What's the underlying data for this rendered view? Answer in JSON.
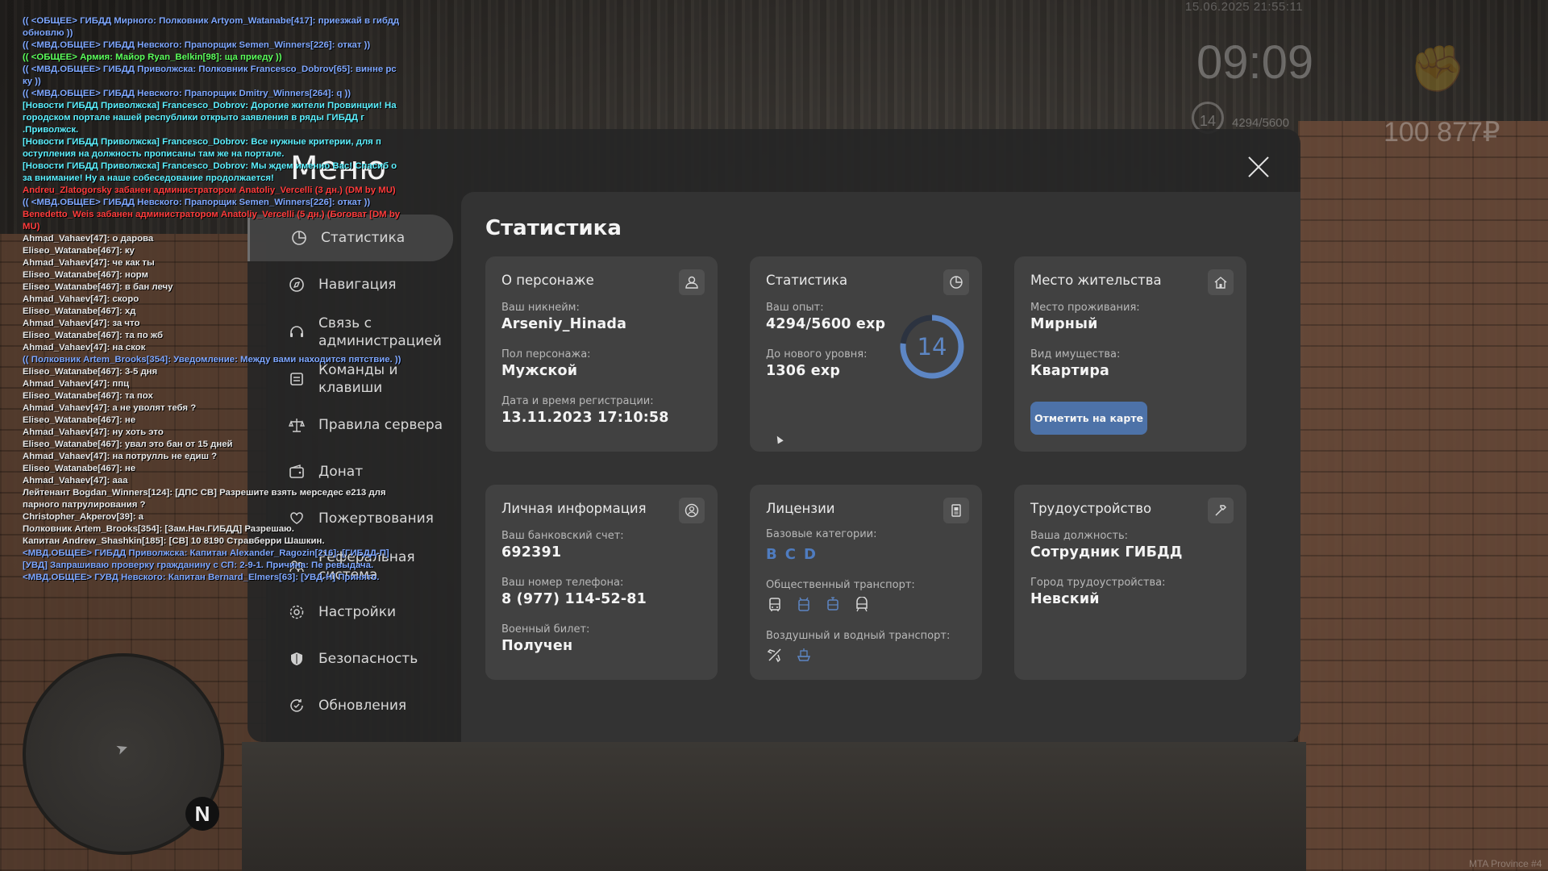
{
  "hud": {
    "date": "15.06.2025 21:55:11",
    "clock": "09:09",
    "level": "14",
    "exp": "4294/5600",
    "money": "100 877₽",
    "watermark": "MTA Province #4"
  },
  "chat": [
    {
      "c": "c-blue",
      "t": "(( <ОБЩЕЕ> ГИБДД Мирного: Полковник Artyom_Watanabe[417]: приезжай в гибдд обновлю ))"
    },
    {
      "c": "c-blue",
      "t": "(( <МВД.ОБЩЕЕ> ГИБДД Невского: Прапорщик Semen_Winners[226]: откат ))"
    },
    {
      "c": "c-green",
      "t": "(( <ОБЩЕЕ> Армия: Майор Ryan_Belkin[98]: ща приеду ))"
    },
    {
      "c": "c-blue",
      "t": "(( <МВД.ОБЩЕЕ> ГИБДД Приволжска: Полковник Francesco_Dobrov[65]: винне рс ку ))"
    },
    {
      "c": "c-blue",
      "t": "(( <МВД.ОБЩЕЕ> ГИБДД Невского: Прапорщик Dmitry_Winners[264]: q ))"
    },
    {
      "c": "c-cyan",
      "t": "[Новости ГИБДД Приволжска] Francesco_Dobrov: Дорогие жители Провинции! На городском портале нашей республики открыто заявления в ряды ГИБДД г .Приволжск."
    },
    {
      "c": "c-cyan",
      "t": "[Новости ГИБДД Приволжска] Francesco_Dobrov: Все нужные критерии, для п оступления на должность прописаны там же на портале."
    },
    {
      "c": "c-cyan",
      "t": "[Новости ГИБДД Приволжска] Francesco_Dobrov: Мы ждем именно Вас! Спасиб о за внимание! Ну а наше собеседование продолжается!"
    },
    {
      "c": "c-red",
      "t": "Andreu_Zlatogorsky забанен администратором Anatoliy_Vercelli (3 дн.) (DM by MU)"
    },
    {
      "c": "c-blue",
      "t": "(( <МВД.ОБЩЕЕ> ГИБДД Невского: Прапорщик Semen_Winners[226]: откат ))"
    },
    {
      "c": "c-red",
      "t": "Benedetto_Weis забанен администратором Anatoliy_Vercelli (5 дн.) (Боговат [DM by MU)"
    },
    {
      "c": "c-white",
      "t": "Ahmad_Vahaev[47]: о дарова"
    },
    {
      "c": "c-white",
      "t": "Eliseo_Watanabe[467]: ку"
    },
    {
      "c": "c-white",
      "t": "Ahmad_Vahaev[47]: че как ты"
    },
    {
      "c": "c-white",
      "t": "Eliseo_Watanabe[467]: норм"
    },
    {
      "c": "c-white",
      "t": "Eliseo_Watanabe[467]: в бан лечу"
    },
    {
      "c": "c-white",
      "t": "Ahmad_Vahaev[47]: скоро"
    },
    {
      "c": "c-white",
      "t": "Eliseo_Watanabe[467]: хд"
    },
    {
      "c": "c-white",
      "t": "Ahmad_Vahaev[47]: за что"
    },
    {
      "c": "c-white",
      "t": "Eliseo_Watanabe[467]: та по жб"
    },
    {
      "c": "c-white",
      "t": "Ahmad_Vahaev[47]: на скок"
    },
    {
      "c": "c-blue",
      "t": "(( Полковник Artem_Brooks[354]: Уведомление: Между вами находится пятствие. ))"
    },
    {
      "c": "c-white",
      "t": "Eliseo_Watanabe[467]: 3-5 дня"
    },
    {
      "c": "c-white",
      "t": "Ahmad_Vahaev[47]: ппц"
    },
    {
      "c": "c-white",
      "t": "Eliseo_Watanabe[467]: та пох"
    },
    {
      "c": "c-white",
      "t": "Ahmad_Vahaev[47]: а не уволят тебя ?"
    },
    {
      "c": "c-white",
      "t": "Eliseo_Watanabe[467]: не"
    },
    {
      "c": "c-white",
      "t": "Ahmad_Vahaev[47]: ну хоть это"
    },
    {
      "c": "c-white",
      "t": "Eliseo_Watanabe[467]: увал это бан от 15 дней"
    },
    {
      "c": "c-white",
      "t": "Ahmad_Vahaev[47]: на потрулль не едиш ?"
    },
    {
      "c": "c-white",
      "t": "Eliseo_Watanabe[467]: не"
    },
    {
      "c": "c-white",
      "t": "Ahmad_Vahaev[47]: ааа"
    },
    {
      "c": "c-white",
      "t": "Лейтенант Bogdan_Winners[124]: [ДПС СВ] Разрешите взять мерседес е213 для парного патрулирования ?"
    },
    {
      "c": "c-white",
      "t": "Christopher_Akperov[39]: а"
    },
    {
      "c": "c-white",
      "t": "Полковник Artem_Brooks[354]: [Зам.Нач.ГИБДД] Разрешаю."
    },
    {
      "c": "c-white",
      "t": "Капитан Andrew_Shashkin[185]: [СВ] 10 8190 Стравберри Шашкин."
    },
    {
      "c": "c-blue",
      "t": "<МВД.ОБЩЕЕ> ГИБДД Приволжска: Капитан Alexander_Ragozin[216]: [ГИБДД-П] [УВД] Запрашиваю проверку гражданину с СП: 2-9-1. Причина: Пе ревыдача."
    },
    {
      "c": "c-blue",
      "t": "<МВД.ОБЩЕЕ> ГУВД Невского: Капитан Bernard_Elmers[63]: [УВД-Н] Принято."
    }
  ],
  "menu": {
    "title": "Меню",
    "sidebar": [
      {
        "label": "Статистика",
        "icon": "chart-pie-icon",
        "active": true
      },
      {
        "label": "Навигация",
        "icon": "compass-icon",
        "active": false
      },
      {
        "label": "Связь с администрацией",
        "icon": "headset-icon",
        "active": false
      },
      {
        "label": "Команды и клавиши",
        "icon": "keyboard-icon",
        "active": false
      },
      {
        "label": "Правила сервера",
        "icon": "scales-icon",
        "active": false
      },
      {
        "label": "Донат",
        "icon": "wallet-icon",
        "active": false
      },
      {
        "label": "Пожертвования",
        "icon": "heart-hand-icon",
        "active": false
      },
      {
        "label": "Реферальная система",
        "icon": "people-icon",
        "active": false
      },
      {
        "label": "Настройки",
        "icon": "gear-icon",
        "active": false
      },
      {
        "label": "Безопасность",
        "icon": "shield-icon",
        "active": false
      },
      {
        "label": "Обновления",
        "icon": "refresh-check-icon",
        "active": false
      }
    ]
  },
  "stats": {
    "title": "Статистика",
    "character": {
      "title": "О персонаже",
      "nickname_label": "Ваш никнейм:",
      "nickname": "Arseniy_Hinada",
      "gender_label": "Пол персонажа:",
      "gender": "Мужской",
      "reg_label": "Дата и время регистрации:",
      "reg": "13.11.2023 17:10:58"
    },
    "statistics": {
      "title": "Статистика",
      "exp_label": "Ваш опыт:",
      "exp": "4294/5600 exp",
      "next_label": "До нового уровня:",
      "next": "1306 exp",
      "level": "14",
      "progress": 0.767
    },
    "residence": {
      "title": "Место жительства",
      "place_label": "Место проживания:",
      "place": "Мирный",
      "property_label": "Вид имущества:",
      "property": "Квартира",
      "button": "Отметить на карте"
    },
    "personal": {
      "title": "Личная информация",
      "bank_label": "Ваш банковский счет:",
      "bank": "692391",
      "phone_label": "Ваш номер телефона:",
      "phone": "8 (977) 114-52-81",
      "military_label": "Военный билет:",
      "military": "Получен"
    },
    "licenses": {
      "title": "Лицензии",
      "base_label": "Базовые категории:",
      "categories": [
        "B",
        "C",
        "D"
      ],
      "public_label": "Общественный транспорт:",
      "public_icons": [
        "bus-icon",
        "trolleybus-icon",
        "tram-icon",
        "train-icon"
      ],
      "air_water_label": "Воздушный и водный транспорт:",
      "air_water_icons": [
        "plane-icon",
        "boat-icon"
      ]
    },
    "employment": {
      "title": "Трудоустройство",
      "position_label": "Ваша должность:",
      "position": "Сотрудник ГИБДД",
      "city_label": "Город трудоустройства:",
      "city": "Невский"
    }
  },
  "colors": {
    "accent": "#4d72a8",
    "category": "#4f7cc0",
    "window": "#262626"
  }
}
